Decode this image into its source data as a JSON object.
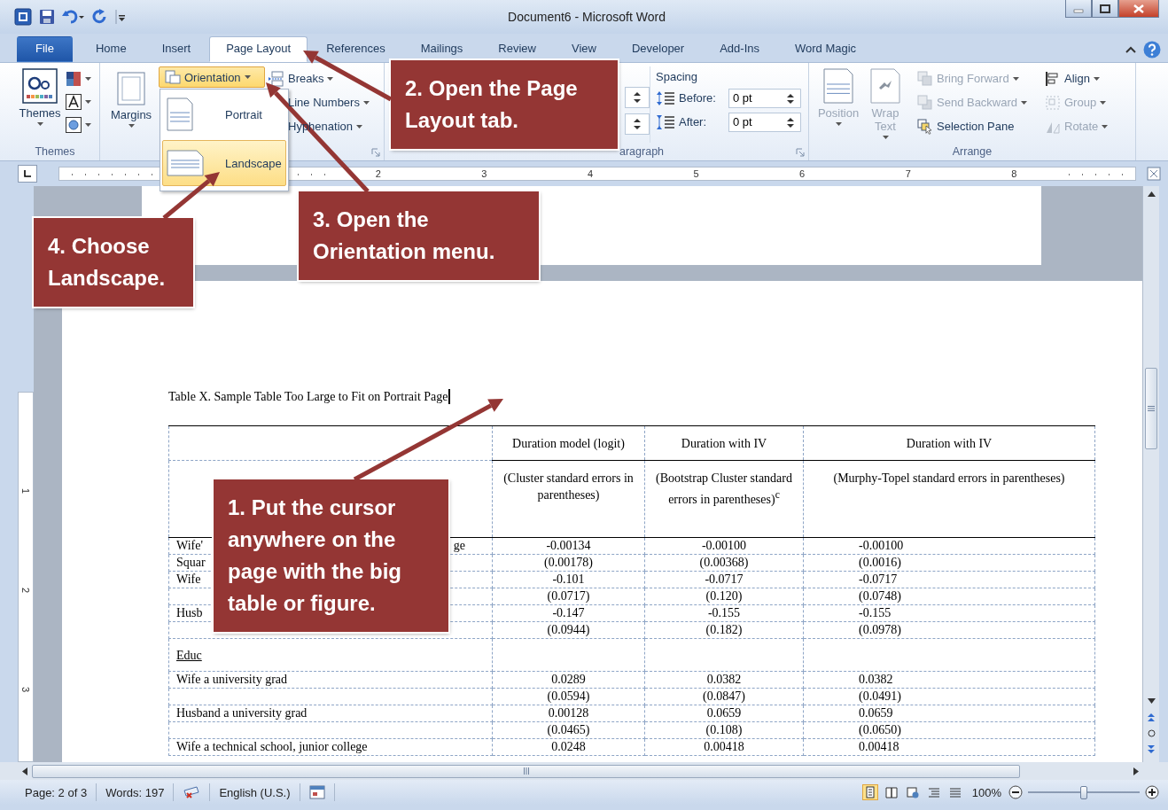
{
  "window": {
    "title": "Document6 - Microsoft Word"
  },
  "ribbon_tabs": [
    {
      "label": "File",
      "kind": "file",
      "selected": false
    },
    {
      "label": "Home",
      "kind": "tab",
      "selected": false
    },
    {
      "label": "Insert",
      "kind": "tab",
      "selected": false
    },
    {
      "label": "Page Layout",
      "kind": "tab",
      "selected": true
    },
    {
      "label": "References",
      "kind": "tab",
      "selected": false
    },
    {
      "label": "Mailings",
      "kind": "tab",
      "selected": false
    },
    {
      "label": "Review",
      "kind": "tab",
      "selected": false
    },
    {
      "label": "View",
      "kind": "tab",
      "selected": false
    },
    {
      "label": "Developer",
      "kind": "tab",
      "selected": false
    },
    {
      "label": "Add-Ins",
      "kind": "tab",
      "selected": false
    },
    {
      "label": "Word Magic",
      "kind": "tab",
      "selected": false
    }
  ],
  "themes_group": {
    "themes_button": "Themes",
    "label": "Themes"
  },
  "page_setup": {
    "margins_button": "Margins",
    "orientation_button": {
      "label": "Orientation",
      "expanded": true
    },
    "items": [
      "Breaks",
      "Line Numbers",
      "Hyphenation"
    ]
  },
  "orientation_menu": [
    {
      "label": "Portrait",
      "selected": false
    },
    {
      "label": "Landscape",
      "selected": true
    }
  ],
  "paragraph_group": {
    "label": "aragraph",
    "spacing": {
      "heading": "Spacing",
      "fields": [
        {
          "label": "Before:",
          "value": "0 pt"
        },
        {
          "label": "After:",
          "value": "0 pt"
        }
      ]
    }
  },
  "arrange_group": {
    "label": "Arrange",
    "large_buttons": [
      {
        "label": "Position",
        "disabled": true
      },
      {
        "label": "Wrap Text",
        "disabled": true
      }
    ],
    "order_buttons": [
      {
        "label": "Bring Forward",
        "disabled": true,
        "dropdown": true
      },
      {
        "label": "Send Backward",
        "disabled": true,
        "dropdown": true
      },
      {
        "label": "Selection Pane",
        "disabled": false,
        "dropdown": false
      }
    ],
    "align_buttons": [
      {
        "label": "Align",
        "disabled": false,
        "dropdown": true
      },
      {
        "label": "Group",
        "disabled": true,
        "dropdown": true
      },
      {
        "label": "Rotate",
        "disabled": true,
        "dropdown": true
      }
    ]
  },
  "ruler": {
    "numbers": [
      "2",
      "3",
      "4",
      "5",
      "6",
      "7",
      "8"
    ]
  },
  "vertical_ruler": {
    "numbers": [
      "1",
      "2",
      "3"
    ]
  },
  "document": {
    "caption": "Table X. Sample Table Too Large to Fit on Portrait Page",
    "columns": [
      {
        "heading": "Duration model (logit)",
        "subheading": "(Cluster standard errors in parentheses)"
      },
      {
        "heading": "Duration with IV",
        "subheading": "(Bootstrap Cluster standard errors in parentheses)$^{c}$"
      },
      {
        "heading": "Duration with IV",
        "subheading": "(Murphy-Topel standard errors in parentheses)"
      }
    ],
    "rows": [
      {
        "kind": "data",
        "label": "Wife'",
        "label_tail": "ge",
        "values": [
          "-0.00134",
          "-0.00100",
          "-0.00100"
        ]
      },
      {
        "kind": "data",
        "label": "Squar",
        "values": [
          "(0.00178)",
          "(0.00368)",
          "(0.0016)"
        ]
      },
      {
        "kind": "data",
        "label": "Wife",
        "values": [
          "-0.101",
          "-0.0717",
          "-0.0717"
        ]
      },
      {
        "kind": "data",
        "values": [
          "(0.0717)",
          "(0.120)",
          "(0.0748)"
        ]
      },
      {
        "kind": "data",
        "label": "Husb",
        "values": [
          "-0.147",
          "-0.155",
          "-0.155"
        ]
      },
      {
        "kind": "data",
        "values": [
          "(0.0944)",
          "(0.182)",
          "(0.0978)"
        ]
      },
      {
        "kind": "section",
        "label": "Educ"
      },
      {
        "kind": "data",
        "label": "Wife a university grad",
        "values": [
          "0.0289",
          "0.0382",
          "0.0382"
        ]
      },
      {
        "kind": "data",
        "values": [
          "(0.0594)",
          "(0.0847)",
          "(0.0491)"
        ]
      },
      {
        "kind": "data",
        "label": "Husband a university grad",
        "values": [
          "0.00128",
          "0.0659",
          "0.0659"
        ]
      },
      {
        "kind": "data",
        "values": [
          "(0.0465)",
          "(0.108)",
          "(0.0650)"
        ]
      },
      {
        "kind": "data",
        "label": "Wife a technical school, junior college",
        "values": [
          "0.0248",
          "0.00418",
          "0.00418"
        ]
      }
    ]
  },
  "status": {
    "page": "Page: 2 of 3",
    "words": "Words: 197",
    "language": "English (U.S.)",
    "zoom": "100%",
    "zoom_slider": {
      "level": 0.5
    }
  },
  "callouts": [
    {
      "text": "1. Put the cursor anywhere on the page with the big table or figure."
    },
    {
      "text": "2. Open the Page Layout tab."
    },
    {
      "text": "3. Open the Orientation menu."
    },
    {
      "text": "4. Choose Landscape."
    }
  ]
}
